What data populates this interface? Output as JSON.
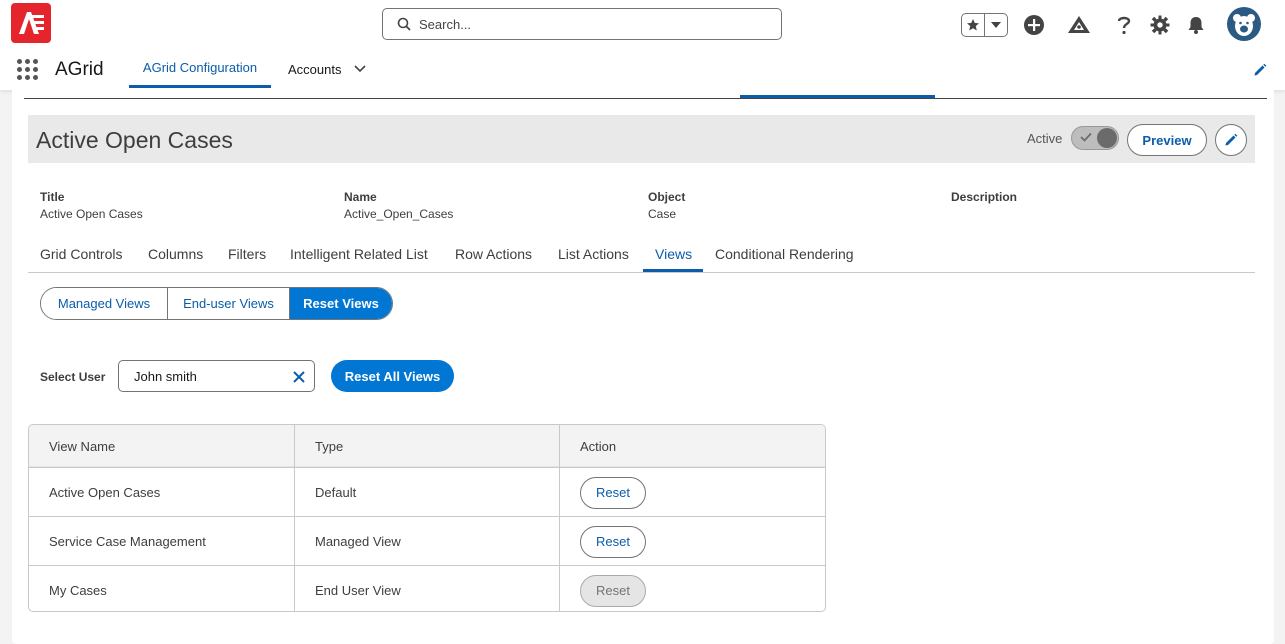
{
  "header": {
    "search_placeholder": "Search..."
  },
  "nav": {
    "app_name": "AGrid",
    "tabs": [
      {
        "label": "AGrid Configuration",
        "active": true
      },
      {
        "label": "Accounts",
        "active": false
      }
    ]
  },
  "record": {
    "title": "Active Open Cases",
    "status_label": "Active",
    "preview_label": "Preview",
    "fields": [
      {
        "label": "Title",
        "value": "Active Open Cases"
      },
      {
        "label": "Name",
        "value": "Active_Open_Cases"
      },
      {
        "label": "Object",
        "value": "Case"
      },
      {
        "label": "Description",
        "value": ""
      }
    ]
  },
  "subtabs": [
    "Grid Controls",
    "Columns",
    "Filters",
    "Intelligent Related List",
    "Row Actions",
    "List Actions",
    "Views",
    "Conditional Rendering"
  ],
  "active_subtab": "Views",
  "segments": [
    {
      "label": "Managed Views",
      "active": false
    },
    {
      "label": "End-user Views",
      "active": false
    },
    {
      "label": "Reset Views",
      "active": true
    }
  ],
  "select_user": {
    "label": "Select User",
    "value": "John smith",
    "reset_all_label": "Reset All Views"
  },
  "table": {
    "columns": [
      "View Name",
      "Type",
      "Action"
    ],
    "rows": [
      {
        "name": "Active Open Cases",
        "type": "Default",
        "action": "Reset",
        "enabled": true
      },
      {
        "name": "Service Case Management",
        "type": "Managed View",
        "action": "Reset",
        "enabled": true
      },
      {
        "name": "My Cases",
        "type": "End User View",
        "action": "Reset",
        "enabled": false
      }
    ]
  },
  "colors": {
    "brand_red": "#e4262c",
    "primary_blue": "#0176d3",
    "link_blue": "#0b5cab"
  }
}
